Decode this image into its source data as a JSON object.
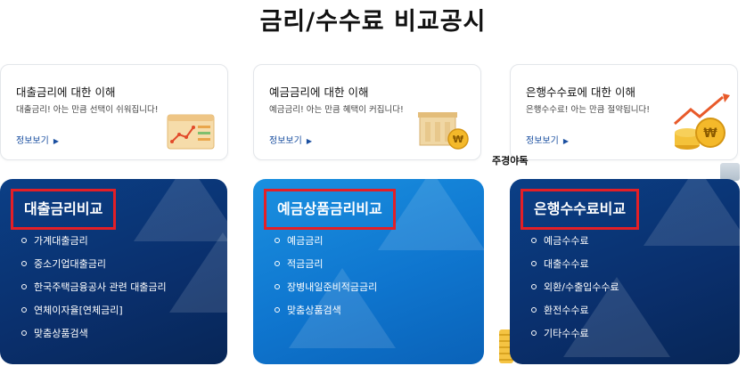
{
  "page": {
    "title": "금리/수수료 비교공시"
  },
  "info_cards": [
    {
      "title": "대출금리에 대한 이해",
      "desc": "대출금리! 아는 만큼 선택이 쉬워집니다!",
      "link": "정보보기",
      "icon": "rising-chart-icon"
    },
    {
      "title": "예금금리에 대한 이해",
      "desc": "예금금리! 아는 만큼 혜택이 커집니다!",
      "link": "정보보기",
      "icon": "bank-coin-icon"
    },
    {
      "title": "은행수수료에 대한 이해",
      "desc": "은행수수료! 아는 만큼 절약됩니다!",
      "link": "정보보기",
      "icon": "coin-stack-arrow-icon"
    }
  ],
  "ad_text": "주경야독",
  "panels": [
    {
      "title": "대출금리비교",
      "items": [
        "가계대출금리",
        "중소기업대출금리",
        "한국주택금융공사 관련 대출금리",
        "연체이자율[연체금리]",
        "맞춤상품검색"
      ]
    },
    {
      "title": "예금상품금리비교",
      "items": [
        "예금금리",
        "적금금리",
        "장병내일준비적금금리",
        "맞춤상품검색"
      ]
    },
    {
      "title": "은행수수료비교",
      "items": [
        "예금수수료",
        "대출수수료",
        "외환/수출입수수료",
        "환전수수료",
        "기타수수료"
      ]
    }
  ],
  "colors": {
    "panel_dark": "#0a2f6c",
    "panel_bright": "#0f76cf",
    "highlight_border": "#e41f26",
    "link": "#1a4fa0"
  }
}
